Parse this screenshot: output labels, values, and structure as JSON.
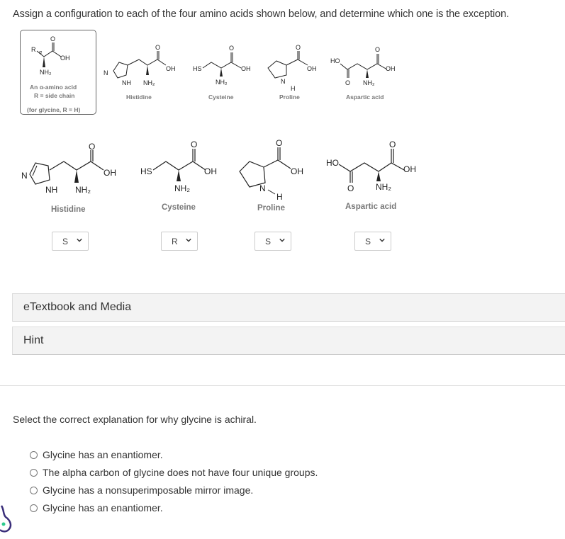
{
  "question": "Assign a configuration to each of the four amino acids shown below, and determine which one is the exception.",
  "reference_figure": {
    "labels": {
      "R": "R",
      "alpha": "α",
      "O": "O",
      "OH": "OH",
      "NH2": "NH₂",
      "HS": "HS",
      "HO": "HO",
      "N": "N",
      "NH": "NH",
      "H": "H"
    },
    "caption_line1": "An α-amino acid",
    "caption_line2": "R = side chain",
    "caption_line3": "(for glycine, R = H)",
    "names": [
      "Histidine",
      "Cysteine",
      "Proline",
      "Aspartic acid"
    ]
  },
  "amino_acids": [
    {
      "name": "Histidine",
      "selected": "S"
    },
    {
      "name": "Cysteine",
      "selected": "R"
    },
    {
      "name": "Proline",
      "selected": "S"
    },
    {
      "name": "Aspartic acid",
      "selected": "S"
    }
  ],
  "panels": {
    "etextbook": "eTextbook and Media",
    "hint": "Hint"
  },
  "part2": {
    "prompt": "Select the correct explanation for why glycine is achiral.",
    "options": [
      "Glycine has an enantiomer.",
      "The alpha carbon of glycine does not have four unique groups.",
      "Glycine has a nonsuperimposable mirror image.",
      "Glycine has an enantiomer."
    ]
  },
  "colors": {
    "accent_dot": "#2ecc8f",
    "assistant_icon": "#3a2e7a"
  }
}
